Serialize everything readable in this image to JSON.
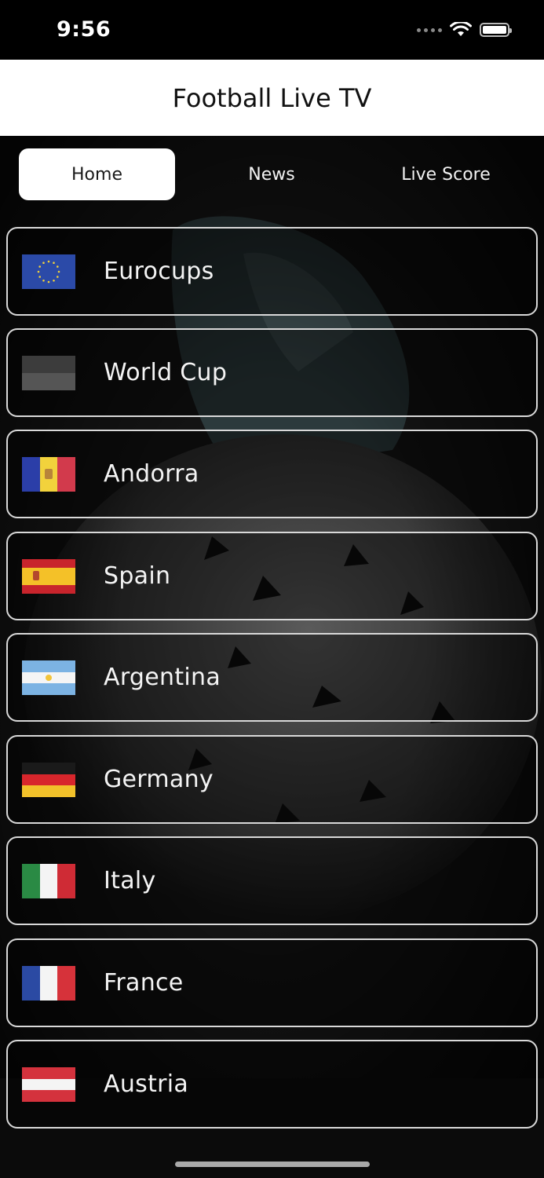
{
  "status_bar": {
    "time": "9:56"
  },
  "header": {
    "title": "Football Live TV"
  },
  "tabs": [
    {
      "label": "Home",
      "active": true
    },
    {
      "label": "News",
      "active": false
    },
    {
      "label": "Live Score",
      "active": false
    }
  ],
  "leagues": [
    {
      "label": "Eurocups",
      "flag": "european-union-flag-icon"
    },
    {
      "label": "World Cup",
      "flag": "world-cup-flag-icon"
    },
    {
      "label": "Andorra",
      "flag": "andorra-flag-icon"
    },
    {
      "label": "Spain",
      "flag": "spain-flag-icon"
    },
    {
      "label": "Argentina",
      "flag": "argentina-flag-icon"
    },
    {
      "label": "Germany",
      "flag": "germany-flag-icon"
    },
    {
      "label": "Italy",
      "flag": "italy-flag-icon"
    },
    {
      "label": "France",
      "flag": "france-flag-icon"
    },
    {
      "label": "Austria",
      "flag": "austria-flag-icon"
    }
  ],
  "colors": {
    "header_bg": "#ffffff",
    "row_border": "#d9d9d9",
    "background": "#000000"
  }
}
